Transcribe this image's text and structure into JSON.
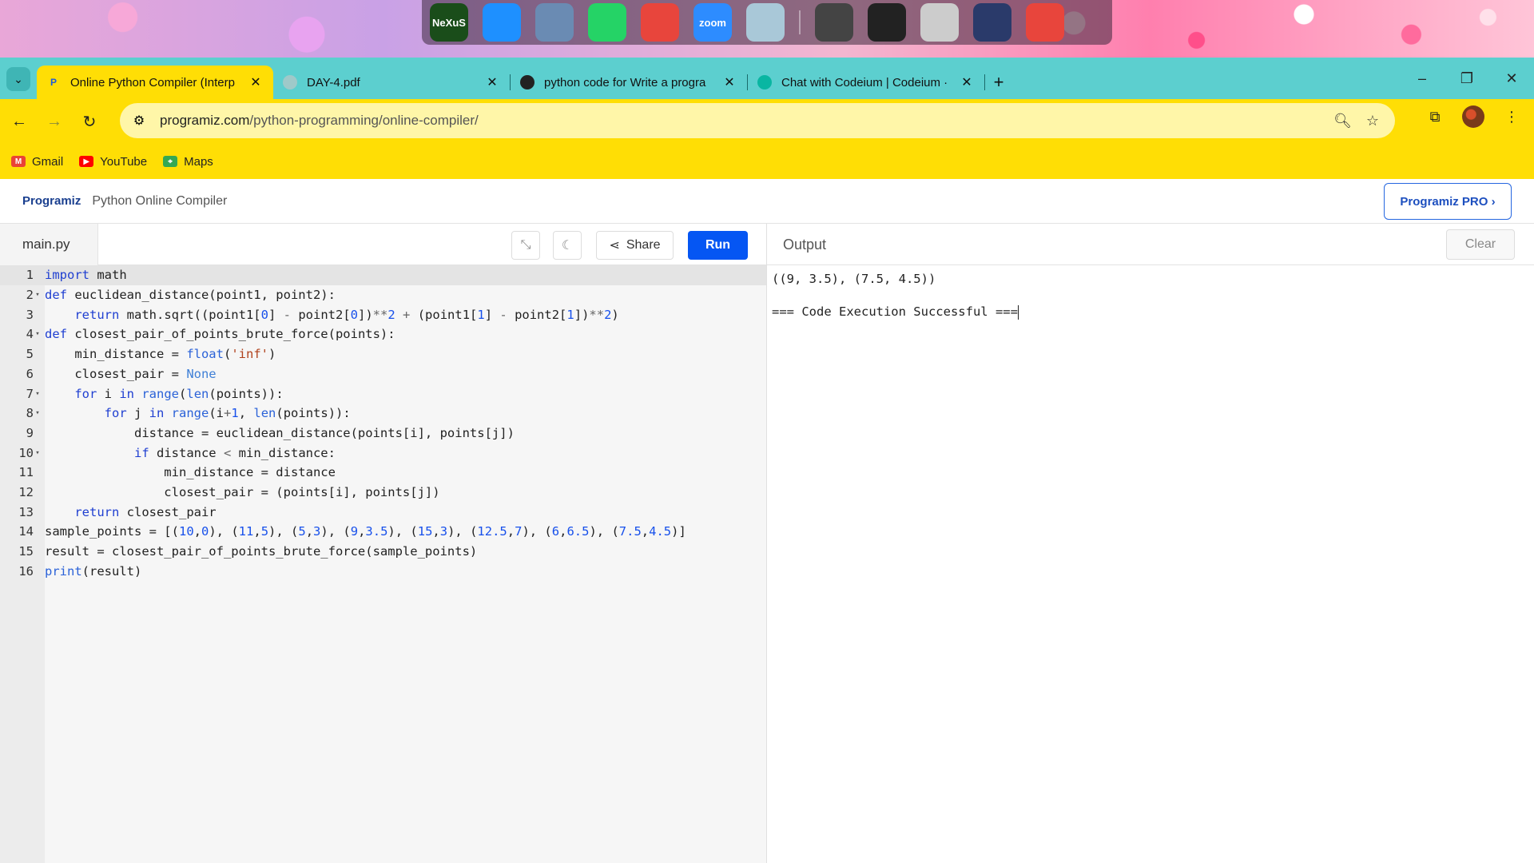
{
  "desktop": {
    "dock_icons": [
      {
        "name": "nexus-icon",
        "label": "NeXuS",
        "color": "#1a4d1a"
      },
      {
        "name": "windows-icon",
        "label": "",
        "color": "#1e90ff"
      },
      {
        "name": "computer-icon",
        "label": "",
        "color": "#6a8bb3"
      },
      {
        "name": "whatsapp-icon",
        "label": "",
        "color": "#25d366"
      },
      {
        "name": "chrome-icon",
        "label": "",
        "color": "#e8453c"
      },
      {
        "name": "zoom-icon",
        "label": "zoom",
        "color": "#2d8cff"
      },
      {
        "name": "recycle-bin-icon",
        "label": "",
        "color": "#a9c8d8"
      },
      {
        "name": "speaker-icon",
        "label": "",
        "color": "#444"
      },
      {
        "name": "camera-icon",
        "label": "",
        "color": "#222"
      },
      {
        "name": "clock-icon",
        "label": "",
        "color": "#ccc"
      },
      {
        "name": "night-mode-icon",
        "label": "",
        "color": "#2a3a6a"
      },
      {
        "name": "power-icon",
        "label": "",
        "color": "#e8453c"
      }
    ]
  },
  "browser": {
    "tabs": [
      {
        "title": "Online Python Compiler (Interp",
        "active": true,
        "favicon_color": "#1d5bdc",
        "favicon_glyph": "P"
      },
      {
        "title": "DAY-4.pdf",
        "active": false,
        "favicon_color": "#9fc9c9",
        "favicon_glyph": ""
      },
      {
        "title": "python code for Write a progra",
        "active": false,
        "favicon_color": "#222",
        "favicon_glyph": ""
      },
      {
        "title": "Chat with Codeium | Codeium ·",
        "active": false,
        "favicon_color": "#09b6a2",
        "favicon_glyph": ""
      }
    ],
    "url_host": "programiz.com",
    "url_path": "/python-programming/online-compiler/",
    "bookmarks": [
      {
        "label": "Gmail",
        "color": "#ea4335",
        "glyph": "M"
      },
      {
        "label": "YouTube",
        "color": "#ff0000",
        "glyph": "▶"
      },
      {
        "label": "Maps",
        "color": "#34a853",
        "glyph": "⌖"
      }
    ]
  },
  "page": {
    "logo": "Programiz",
    "title": "Python Online Compiler",
    "pro_button": "Programiz PRO ›",
    "file_tab": "main.py",
    "share_label": "Share",
    "run_label": "Run",
    "output_title": "Output",
    "clear_label": "Clear"
  },
  "code_lines": [
    "import math",
    "def euclidean_distance(point1, point2):",
    "    return math.sqrt((point1[0] - point2[0])**2 + (point1[1] - point2[1])**2)",
    "def closest_pair_of_points_brute_force(points):",
    "    min_distance = float('inf')",
    "    closest_pair = None",
    "    for i in range(len(points)):",
    "        for j in range(i+1, len(points)):",
    "            distance = euclidean_distance(points[i], points[j])",
    "            if distance < min_distance:",
    "                min_distance = distance",
    "                closest_pair = (points[i], points[j])",
    "    return closest_pair",
    "sample_points = [(10,0), (11,5), (5,3), (9,3.5), (15,3), (12.5,7), (6,6.5), (7.5,4.5)]",
    "result = closest_pair_of_points_brute_force(sample_points)",
    "print(result)"
  ],
  "foldable_lines": [
    2,
    4,
    7,
    8,
    10
  ],
  "output_lines": [
    "((9, 3.5), (7.5, 4.5))",
    "",
    "=== Code Execution Successful ==="
  ]
}
